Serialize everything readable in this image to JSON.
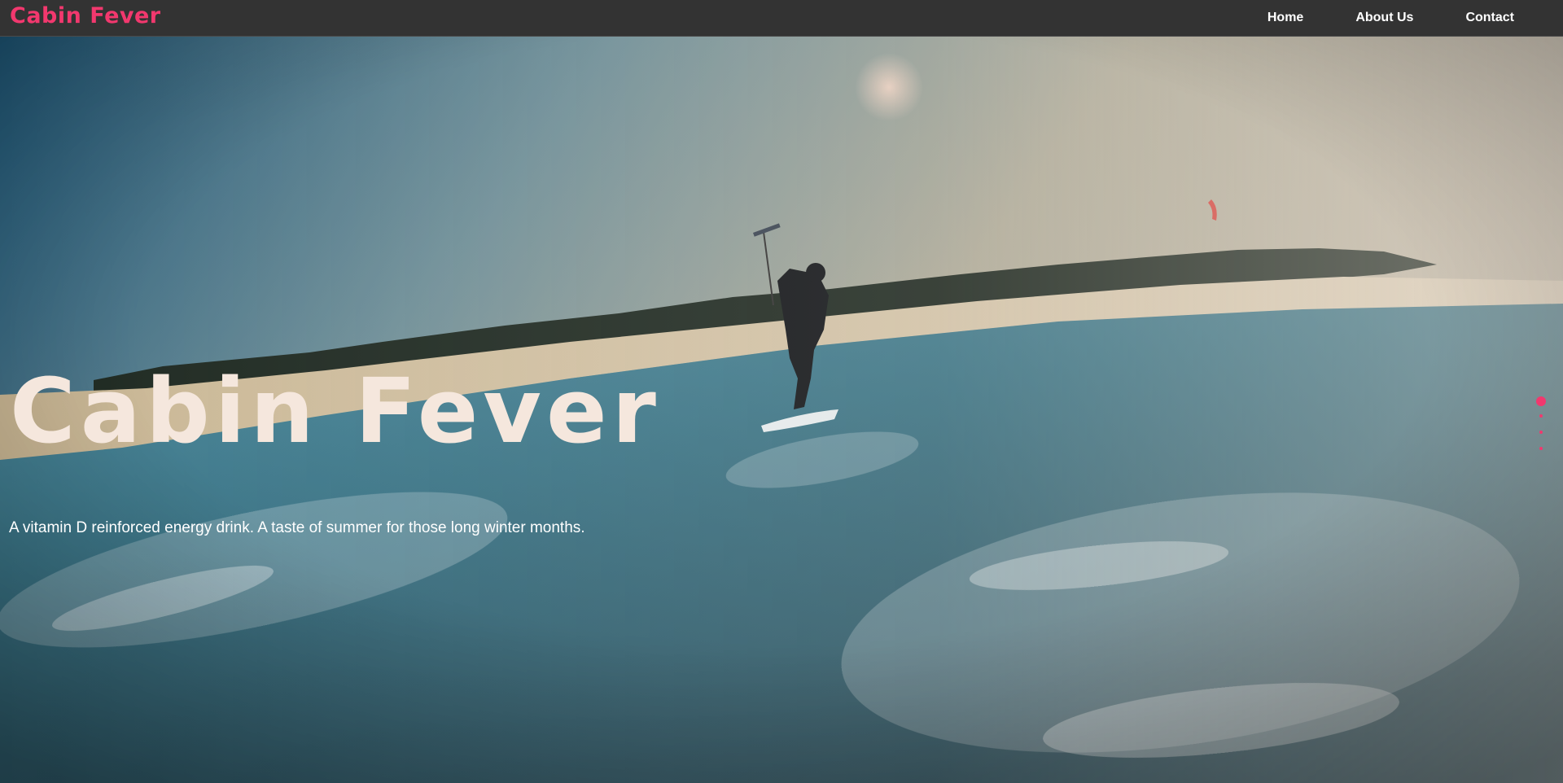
{
  "brand": {
    "name": "Cabin Fever",
    "color": "#f2386e"
  },
  "nav": {
    "items": [
      {
        "label": "Home"
      },
      {
        "label": "About Us"
      },
      {
        "label": "Contact"
      }
    ]
  },
  "hero": {
    "title": "Cabin Fever",
    "subtitle": "A vitamin D reinforced energy drink. A taste of summer for those long winter months.",
    "title_color": "#f5e7dd",
    "slide_count": 4,
    "active_slide": 1
  }
}
